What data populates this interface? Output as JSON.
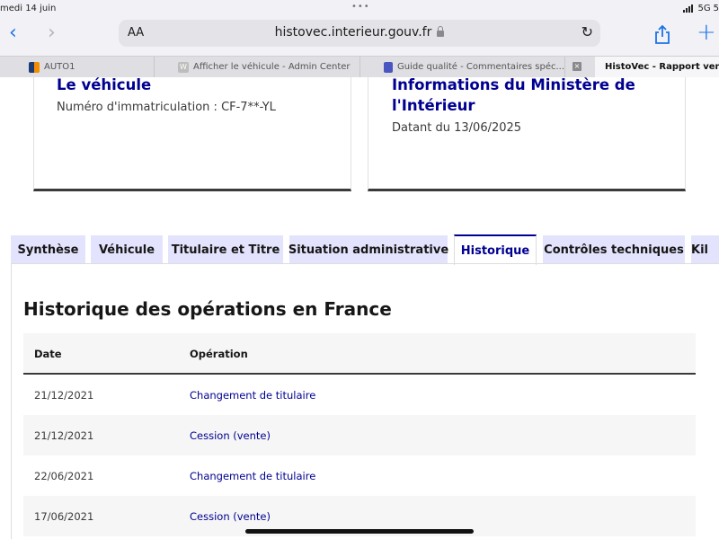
{
  "status_bar": {
    "time": "medi 14 juin",
    "dots": "•••",
    "network": "5G",
    "battery": "5"
  },
  "browser": {
    "text_size_button": "AA",
    "url": "histovec.interieur.gouv.fr",
    "tabs": [
      {
        "label": "AUTO1",
        "favicon_color": "#f28c00",
        "active": false
      },
      {
        "label": "Afficher le véhicule - Admin Center",
        "favicon_color": "#bdbdbd",
        "active": false
      },
      {
        "label": "Guide qualité - Commentaires spéc...",
        "favicon_color": "#4a56c0",
        "active": false
      },
      {
        "label": "HistoVec - Rapport vend",
        "favicon_color": "#000091",
        "active": true
      }
    ],
    "close_tab": "×"
  },
  "cards": [
    {
      "title": "Le véhicule",
      "subtitle": "Numéro d'immatriculation : CF-7**-YL"
    },
    {
      "title_line1": "Informations du Ministère de",
      "title_line2": "l'Intérieur",
      "subtitle": "Datant du 13/06/2025"
    }
  ],
  "tabs": [
    {
      "label": "Synthèse"
    },
    {
      "label": "Véhicule"
    },
    {
      "label": "Titulaire et Titre"
    },
    {
      "label": "Situation administrative"
    },
    {
      "label": "Historique",
      "active": true
    },
    {
      "label": "Contrôles techniques"
    },
    {
      "label": "Kil"
    }
  ],
  "history": {
    "title": "Historique des opérations en France",
    "columns": [
      "Date",
      "Opération"
    ],
    "rows": [
      {
        "date": "21/12/2021",
        "operation": "Changement de titulaire"
      },
      {
        "date": "21/12/2021",
        "operation": "Cession (vente)"
      },
      {
        "date": "22/06/2021",
        "operation": "Changement de titulaire"
      },
      {
        "date": "17/06/2021",
        "operation": "Cession (vente)"
      }
    ]
  },
  "colors": {
    "accent": "#000091",
    "tab_background": "#e3e3fd",
    "ios_blue": "#1a73e8"
  }
}
